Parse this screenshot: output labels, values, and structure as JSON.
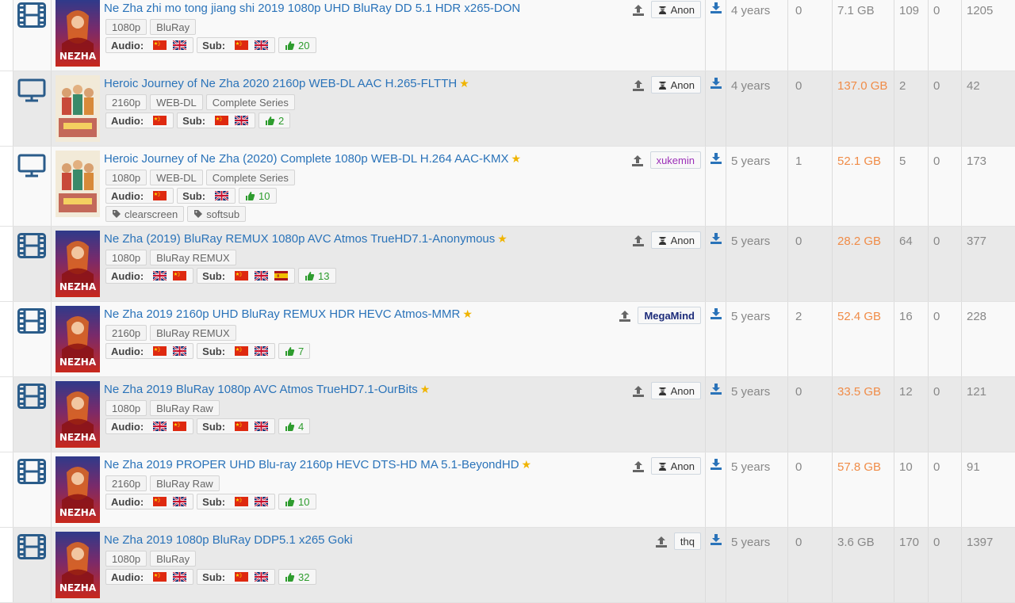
{
  "rows": [
    {
      "category": "movie",
      "title": "Ne Zha zhi mo tong jiang shi 2019 1080p UHD BluRay DD 5.1 HDR x265-DON",
      "starred": false,
      "tags": [
        "1080p",
        "BluRay"
      ],
      "audio": [
        "cn",
        "uk"
      ],
      "subs": [
        "cn",
        "uk"
      ],
      "likes": "20",
      "extra_tags": [],
      "uploader": "Anon",
      "uploader_style": "anon",
      "age": "4 years",
      "comments": "0",
      "size": "7.1 GB",
      "size_highlight": false,
      "seeders": "109",
      "leechers": "0",
      "completed": "1205"
    },
    {
      "category": "tv",
      "title": "Heroic Journey of Ne Zha 2020 2160p WEB-DL AAC H.265-FLTTH",
      "starred": true,
      "tags": [
        "2160p",
        "WEB-DL",
        "Complete Series"
      ],
      "audio": [
        "cn"
      ],
      "subs": [
        "cn",
        "uk"
      ],
      "likes": "2",
      "extra_tags": [],
      "uploader": "Anon",
      "uploader_style": "anon",
      "age": "4 years",
      "comments": "0",
      "size": "137.0 GB",
      "size_highlight": true,
      "seeders": "2",
      "leechers": "0",
      "completed": "42"
    },
    {
      "category": "tv",
      "title": "Heroic Journey of Ne Zha (2020) Complete 1080p WEB-DL H.264 AAC-KMX",
      "starred": true,
      "tags": [
        "1080p",
        "WEB-DL",
        "Complete Series"
      ],
      "audio": [
        "cn"
      ],
      "subs": [
        "uk"
      ],
      "likes": "10",
      "extra_tags": [
        "clearscreen",
        "softsub"
      ],
      "uploader": "xukemin",
      "uploader_style": "purple",
      "age": "5 years",
      "comments": "1",
      "size": "52.1 GB",
      "size_highlight": true,
      "seeders": "5",
      "leechers": "0",
      "completed": "173"
    },
    {
      "category": "movie",
      "title": "Ne Zha (2019) BluRay REMUX 1080p AVC Atmos TrueHD7.1-Anonymous",
      "starred": true,
      "tags": [
        "1080p",
        "BluRay REMUX"
      ],
      "audio": [
        "uk",
        "cn"
      ],
      "subs": [
        "cn",
        "uk",
        "es"
      ],
      "likes": "13",
      "extra_tags": [],
      "uploader": "Anon",
      "uploader_style": "anon",
      "age": "5 years",
      "comments": "0",
      "size": "28.2 GB",
      "size_highlight": true,
      "seeders": "64",
      "leechers": "0",
      "completed": "377"
    },
    {
      "category": "movie",
      "title": "Ne Zha 2019 2160p UHD BluRay REMUX HDR HEVC Atmos-MMR",
      "starred": true,
      "tags": [
        "2160p",
        "BluRay REMUX"
      ],
      "audio": [
        "cn",
        "uk"
      ],
      "subs": [
        "cn",
        "uk"
      ],
      "likes": "7",
      "extra_tags": [],
      "uploader": "MegaMind",
      "uploader_style": "navy",
      "age": "5 years",
      "comments": "2",
      "size": "52.4 GB",
      "size_highlight": true,
      "seeders": "16",
      "leechers": "0",
      "completed": "228"
    },
    {
      "category": "movie",
      "title": "Ne Zha 2019 BluRay 1080p AVC Atmos TrueHD7.1-OurBits",
      "starred": true,
      "tags": [
        "1080p",
        "BluRay Raw"
      ],
      "audio": [
        "uk",
        "cn"
      ],
      "subs": [
        "cn",
        "uk"
      ],
      "likes": "4",
      "extra_tags": [],
      "uploader": "Anon",
      "uploader_style": "anon",
      "age": "5 years",
      "comments": "0",
      "size": "33.5 GB",
      "size_highlight": true,
      "seeders": "12",
      "leechers": "0",
      "completed": "121"
    },
    {
      "category": "movie",
      "title": "Ne Zha 2019 PROPER UHD Blu-ray 2160p HEVC DTS-HD MA 5.1-BeyondHD",
      "starred": true,
      "tags": [
        "2160p",
        "BluRay Raw"
      ],
      "audio": [
        "cn",
        "uk"
      ],
      "subs": [
        "cn",
        "uk"
      ],
      "likes": "10",
      "extra_tags": [],
      "uploader": "Anon",
      "uploader_style": "anon",
      "age": "5 years",
      "comments": "0",
      "size": "57.8 GB",
      "size_highlight": true,
      "seeders": "10",
      "leechers": "0",
      "completed": "91"
    },
    {
      "category": "movie",
      "title": "Ne Zha 2019 1080p BluRay DDP5.1 x265 Goki",
      "starred": false,
      "tags": [
        "1080p",
        "BluRay"
      ],
      "audio": [
        "cn",
        "uk"
      ],
      "subs": [
        "cn",
        "uk"
      ],
      "likes": "32",
      "extra_tags": [],
      "uploader": "thq",
      "uploader_style": "plain",
      "age": "5 years",
      "comments": "0",
      "size": "3.6 GB",
      "size_highlight": false,
      "seeders": "170",
      "leechers": "0",
      "completed": "1397"
    }
  ],
  "labels": {
    "audio": "Audio:",
    "subs": "Sub:"
  },
  "poster": {
    "movie_text": "NEZHA"
  },
  "colors": {
    "link": "#2a73b9",
    "star": "#f0b400",
    "size_highlight": "#f08c48",
    "likes": "#2e9c2e",
    "icon": "#2a5c8a",
    "download": "#2a73b9",
    "upload": "#666666",
    "xukemin": "#9b2fb8",
    "megamind": "#1d2c7a",
    "row_alt": "#e9e9e9",
    "row_plain": "#f9f9f9"
  },
  "icons": {
    "movie": "film-icon",
    "tv": "tv-monitor-icon",
    "upload": "upload-icon",
    "download": "download-icon",
    "anon": "user-secret-icon",
    "tag": "tag-icon",
    "like": "thumbs-up-icon",
    "star": "star-icon"
  }
}
